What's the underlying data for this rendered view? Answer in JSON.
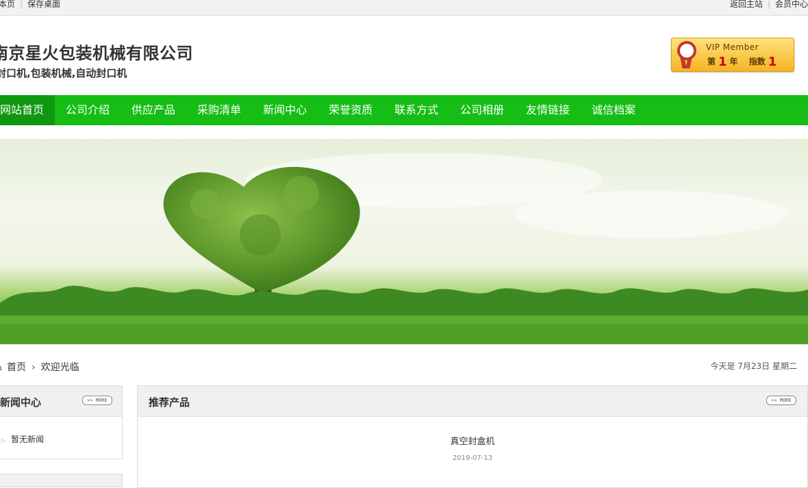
{
  "topbar": {
    "left_items": [
      "藏本页",
      "保存桌面"
    ],
    "right_items": [
      "返回主站",
      "会员中心"
    ]
  },
  "header": {
    "company_name": "南京星火包装机械有限公司",
    "subtitle": "封口机,包装机械,自动封口机"
  },
  "vip": {
    "title": "VIP Member",
    "year_prefix": "第",
    "year_value": "1",
    "year_suffix": "年",
    "index_label": "指数",
    "index_value": "1"
  },
  "nav": {
    "items": [
      {
        "label": "网站首页",
        "active": true
      },
      {
        "label": "公司介绍"
      },
      {
        "label": "供应产品"
      },
      {
        "label": "采购清单"
      },
      {
        "label": "新闻中心"
      },
      {
        "label": "荣誉资质"
      },
      {
        "label": "联系方式"
      },
      {
        "label": "公司相册"
      },
      {
        "label": "友情链接"
      },
      {
        "label": "诚信档案"
      }
    ]
  },
  "breadcrumb": {
    "home": "首页",
    "current": "欢迎光临",
    "date_text": "今天是 7月23日 星期二"
  },
  "news_panel": {
    "title": "新闻中心",
    "more_label": ">> MORE",
    "empty_text": "暂无新闻"
  },
  "products_panel": {
    "title": "推荐产品",
    "more_label": ">> MORE",
    "items": [
      {
        "name": "真空封盒机",
        "date": "2019-07-13"
      }
    ]
  },
  "colors": {
    "nav_bg": "#15bd15",
    "nav_active_bg": "#109710",
    "vip_gold": "#f6b427"
  },
  "icons": [
    "home-icon",
    "chevron-right-icon",
    "triangle-bullet-icon",
    "medal-icon"
  ]
}
